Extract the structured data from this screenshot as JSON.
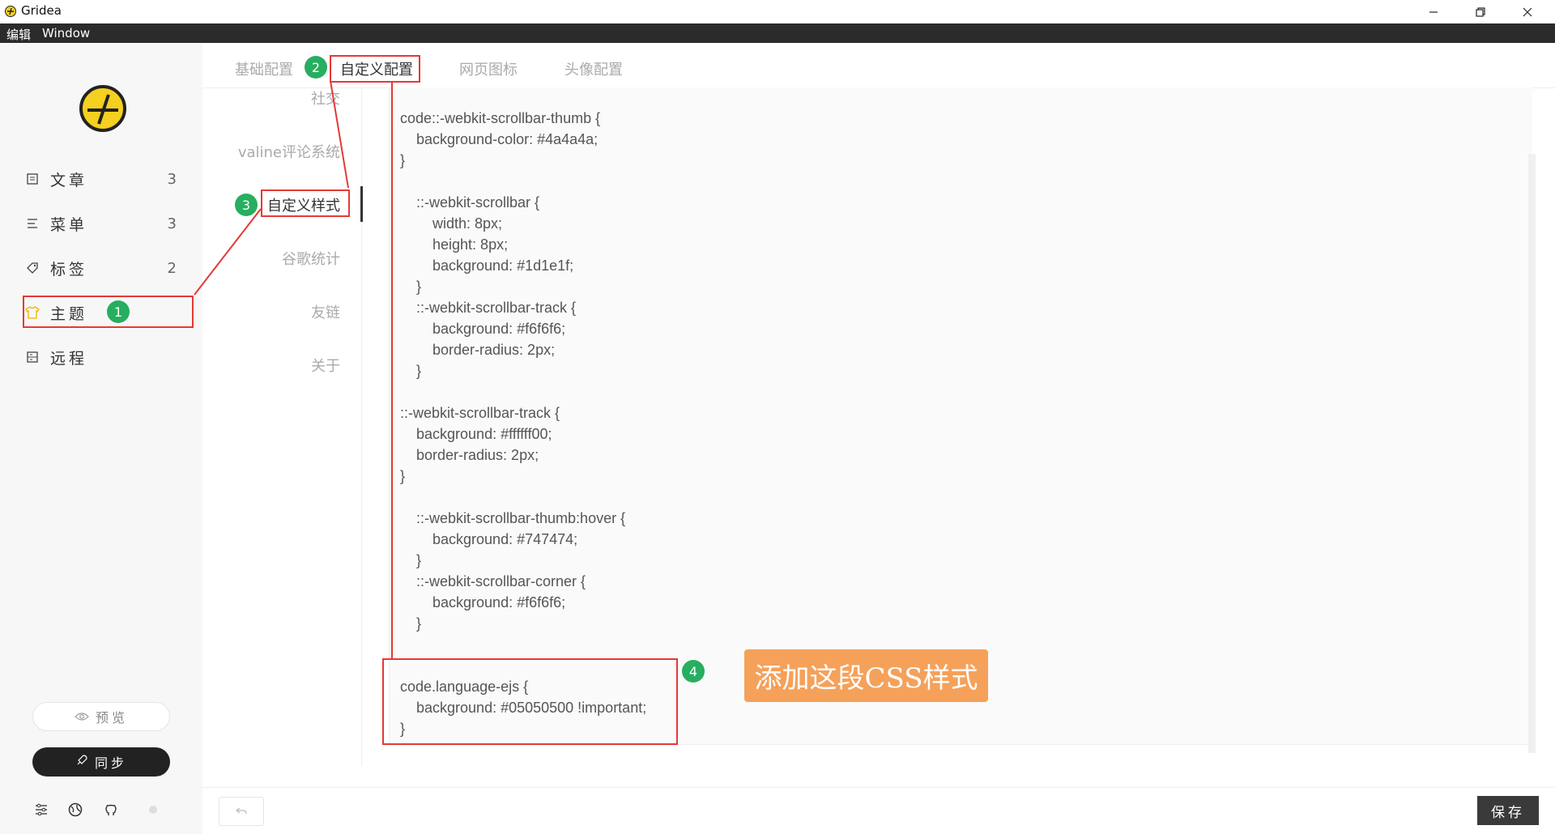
{
  "window": {
    "title": "Gridea"
  },
  "menu": {
    "items": [
      "编辑",
      "Window"
    ]
  },
  "sidebar": {
    "items": [
      {
        "label": "文章",
        "count": "3",
        "icon": "document-icon"
      },
      {
        "label": "菜单",
        "count": "3",
        "icon": "list-icon"
      },
      {
        "label": "标签",
        "count": "2",
        "icon": "tag-icon"
      },
      {
        "label": "主题",
        "count": "",
        "icon": "shirt-icon"
      },
      {
        "label": "远程",
        "count": "",
        "icon": "server-icon"
      }
    ],
    "preview_label": "预览",
    "sync_label": "同步",
    "bottom_icons": [
      "settings-sliders-icon",
      "globe-icon",
      "github-icon",
      "status-dot-icon"
    ]
  },
  "tabs": [
    {
      "label": "基础配置"
    },
    {
      "label": "自定义配置"
    },
    {
      "label": "网页图标"
    },
    {
      "label": "头像配置"
    }
  ],
  "subnav": [
    {
      "label": "社交"
    },
    {
      "label": "valine评论系统"
    },
    {
      "label": "自定义样式"
    },
    {
      "label": "谷歌统计"
    },
    {
      "label": "友链"
    },
    {
      "label": "关于"
    }
  ],
  "editor": {
    "code": "code::-webkit-scrollbar-thumb {\n    background-color: #4a4a4a;\n}\n\n    ::-webkit-scrollbar {\n        width: 8px;\n        height: 8px;\n        background: #1d1e1f;\n    }\n    ::-webkit-scrollbar-track {\n        background: #f6f6f6;\n        border-radius: 2px;\n    }\n\n::-webkit-scrollbar-track {\n    background: #ffffff00;\n    border-radius: 2px;\n}\n\n    ::-webkit-scrollbar-thumb:hover {\n        background: #747474;\n    }\n    ::-webkit-scrollbar-corner {\n        background: #f6f6f6;\n    }\n\n\ncode.language-ejs {\n    background: #05050500 !important;\n}"
  },
  "footer": {
    "save_label": "保存"
  },
  "annotations": {
    "badges": [
      "1",
      "2",
      "3",
      "4"
    ],
    "callout": "添加这段CSS样式",
    "colors": {
      "box": "#e53935",
      "badge": "#27ae60",
      "callout": "#f5a15a"
    }
  }
}
